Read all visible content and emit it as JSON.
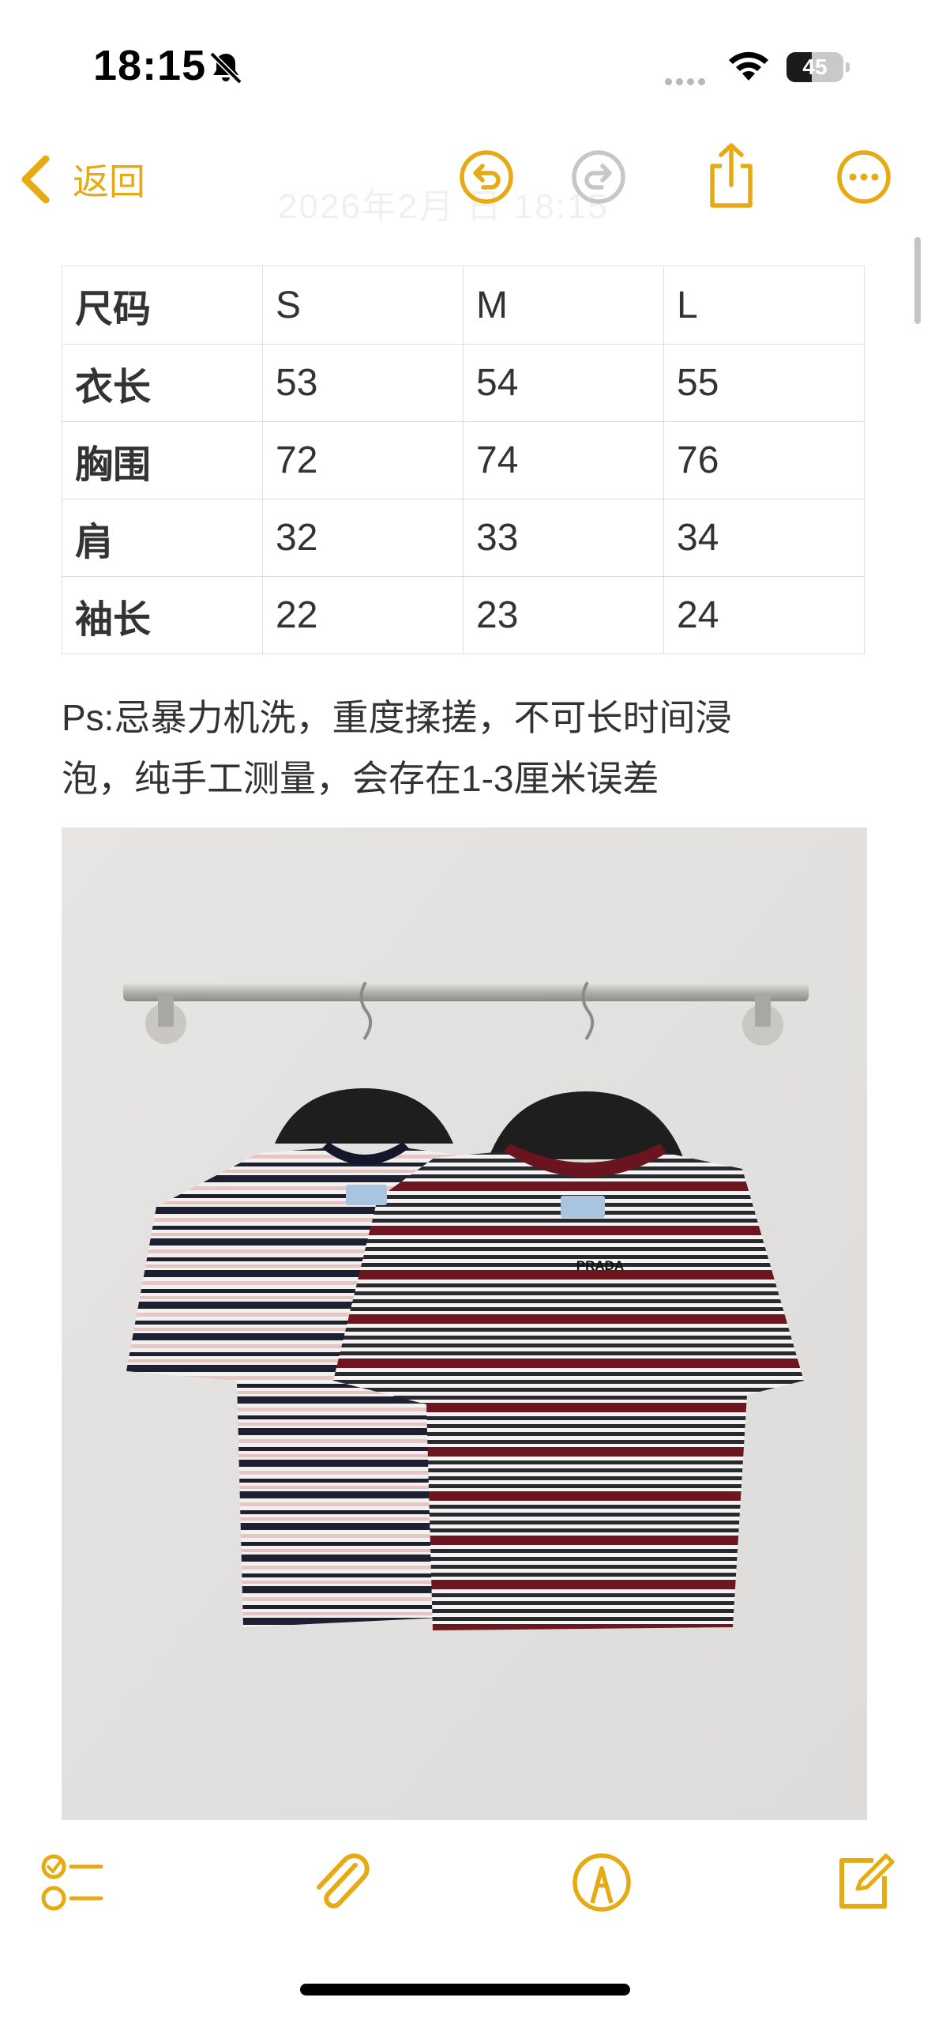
{
  "status_bar": {
    "time": "18:15",
    "battery_level": "45",
    "battery_fraction": 0.45
  },
  "nav": {
    "back_label": "返回",
    "faded_date": "2026年2月 日 18:15",
    "icons": [
      "back-chevron-icon",
      "undo-icon",
      "redo-icon",
      "share-icon",
      "more-icon"
    ]
  },
  "colors": {
    "accent": "#E6AB14",
    "text": "#333333",
    "disabled": "#C7C7C7",
    "border": "#DEDEDE"
  },
  "size_table": {
    "header": [
      "尺码",
      "S",
      "M",
      "L"
    ],
    "rows": [
      [
        "衣长",
        "53",
        "54",
        "55"
      ],
      [
        "胸围",
        "72",
        "74",
        "76"
      ],
      [
        "肩",
        "32",
        "33",
        "34"
      ],
      [
        "袖长",
        "22",
        "23",
        "24"
      ]
    ]
  },
  "note": {
    "line1": "Ps:忌暴力机洗，重度揉搓，不可长时间浸",
    "line2": "泡，纯手工测量，会存在1-3厘米误差"
  },
  "photo": {
    "brand_label": "PRADA"
  },
  "toolbar": {
    "icons": [
      "checklist-icon",
      "attachment-icon",
      "markup-icon",
      "compose-icon"
    ]
  }
}
